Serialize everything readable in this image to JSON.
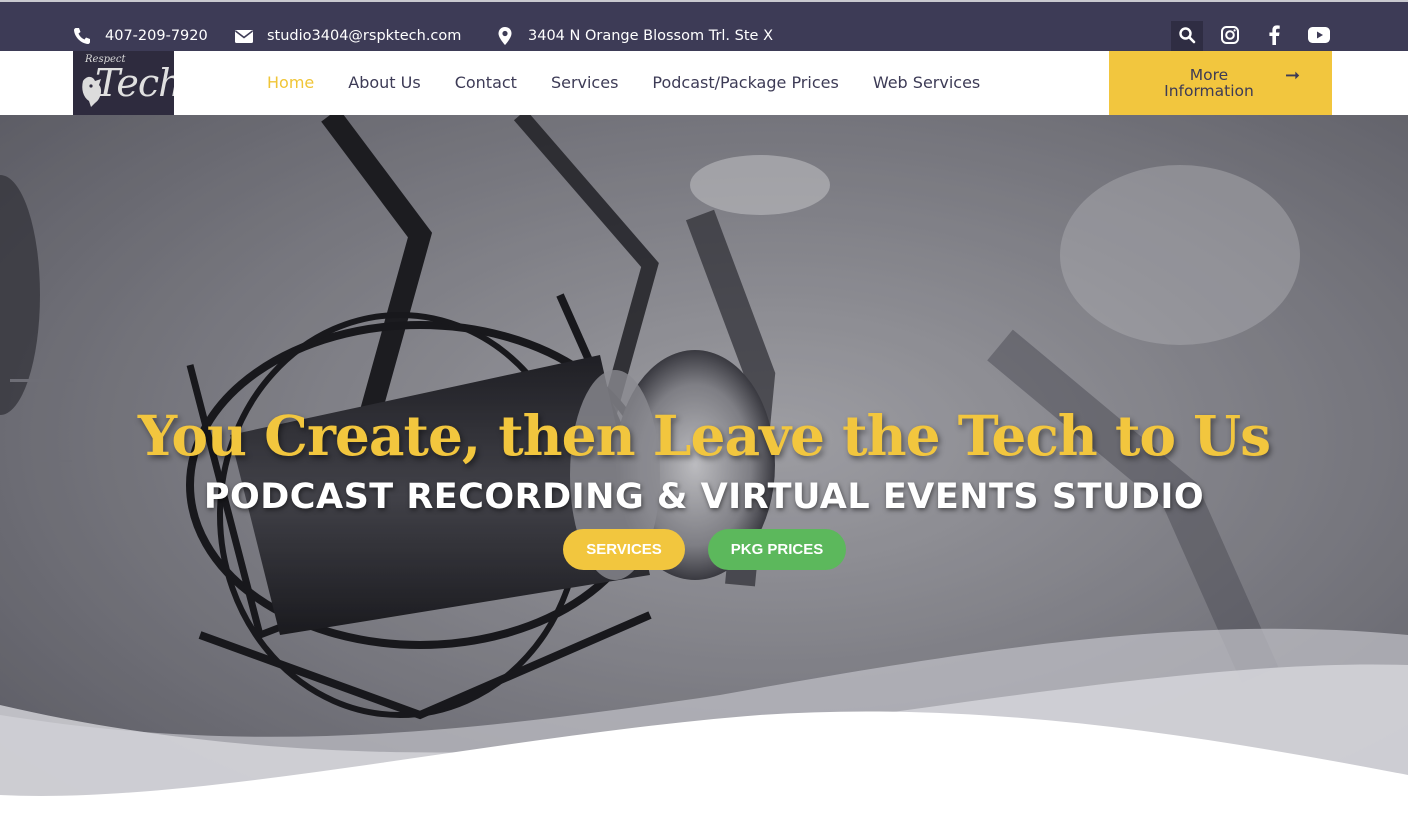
{
  "topbar": {
    "phone": "407-209-7920",
    "email": "studio3404@rspktech.com",
    "address": "3404 N Orange Blossom Trl. Ste X",
    "icons": [
      "phone-icon",
      "envelope-icon",
      "map-pin-icon",
      "search-icon",
      "instagram-icon",
      "facebook-icon",
      "youtube-icon"
    ]
  },
  "logo": {
    "word1": "Respect",
    "word2": "Tech"
  },
  "nav": {
    "items": [
      {
        "label": "Home",
        "active": true
      },
      {
        "label": "About Us"
      },
      {
        "label": "Contact"
      },
      {
        "label": "Services"
      },
      {
        "label": "Podcast/Package Prices"
      },
      {
        "label": "Web Services"
      }
    ],
    "cta_label": "More Information"
  },
  "hero": {
    "headline": "You Create, then Leave the Tech to Us",
    "subhead": "PODCAST RECORDING & VIRTUAL EVENTS STUDIO",
    "buttons": {
      "services": "SERVICES",
      "pkg_prices": "PKG PRICES"
    }
  },
  "colors": {
    "topbar_bg": "#3d3b56",
    "accent_yellow": "#f2c63e",
    "accent_green": "#5cb85c",
    "nav_text": "#3d3b56"
  }
}
